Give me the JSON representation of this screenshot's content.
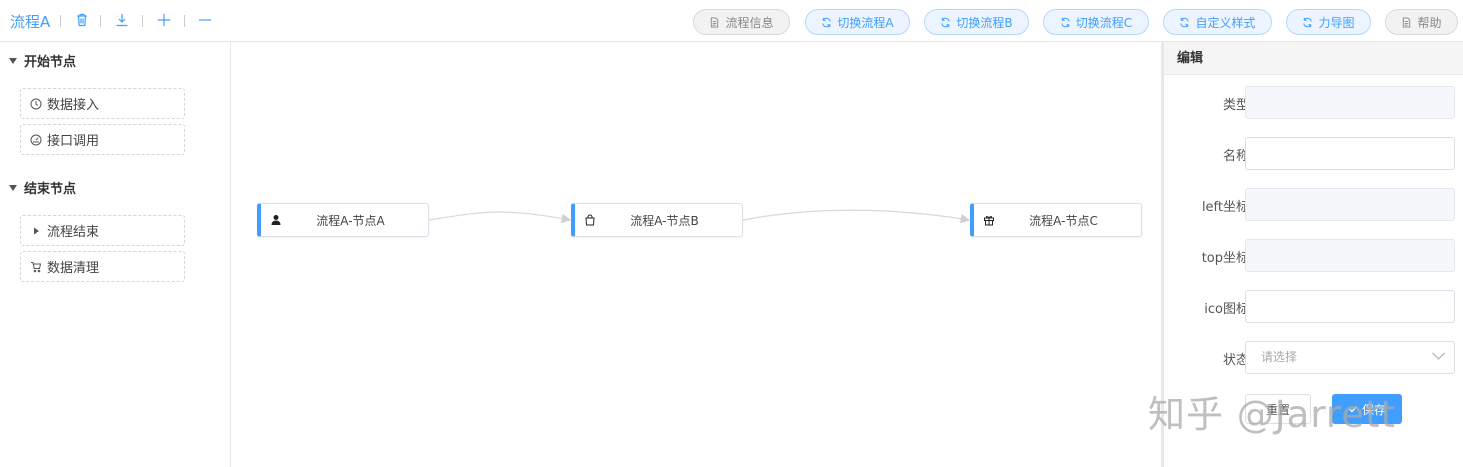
{
  "toolbar": {
    "title": "流程A",
    "tools": [
      {
        "name": "delete-icon"
      },
      {
        "name": "download-icon"
      },
      {
        "name": "zoom-in-icon"
      },
      {
        "name": "zoom-out-icon"
      }
    ],
    "buttons": [
      {
        "label": "流程信息",
        "style": "grey",
        "icon": "document-icon"
      },
      {
        "label": "切换流程A",
        "style": "blue",
        "icon": "refresh-icon"
      },
      {
        "label": "切换流程B",
        "style": "blue",
        "icon": "refresh-icon"
      },
      {
        "label": "切换流程C",
        "style": "blue",
        "icon": "refresh-icon"
      },
      {
        "label": "自定义样式",
        "style": "blue",
        "icon": "refresh-icon"
      },
      {
        "label": "力导图",
        "style": "blue",
        "icon": "refresh-icon"
      },
      {
        "label": "帮助",
        "style": "grey",
        "icon": "document-icon"
      }
    ]
  },
  "sidebar": {
    "groups": [
      {
        "label": "开始节点",
        "items": [
          {
            "label": "数据接入",
            "icon": "clock-icon"
          },
          {
            "label": "接口调用",
            "icon": "gauge-icon"
          }
        ]
      },
      {
        "label": "结束节点",
        "items": [
          {
            "label": "流程结束",
            "icon": "caret-right-icon"
          },
          {
            "label": "数据清理",
            "icon": "cart-icon"
          }
        ]
      }
    ]
  },
  "canvas": {
    "nodes": [
      {
        "label": "流程A-节点A",
        "icon": "user-icon"
      },
      {
        "label": "流程A-节点B",
        "icon": "bag-icon"
      },
      {
        "label": "流程A-节点C",
        "icon": "gift-icon"
      }
    ]
  },
  "editor": {
    "title": "编辑",
    "fields": [
      {
        "label": "类型",
        "value": "",
        "disabled": true
      },
      {
        "label": "名称",
        "value": "",
        "disabled": false
      },
      {
        "label": "left坐标",
        "value": "",
        "disabled": true
      },
      {
        "label": "top坐标",
        "value": "",
        "disabled": true
      },
      {
        "label": "ico图标",
        "value": "",
        "disabled": false
      },
      {
        "label": "状态",
        "placeholder": "请选择",
        "type": "select"
      }
    ],
    "reset_label": "重置",
    "save_label": "保存"
  },
  "watermark": "知乎 @Jarrett",
  "colors": {
    "accent": "#409eff",
    "node_border": "#409eff"
  }
}
